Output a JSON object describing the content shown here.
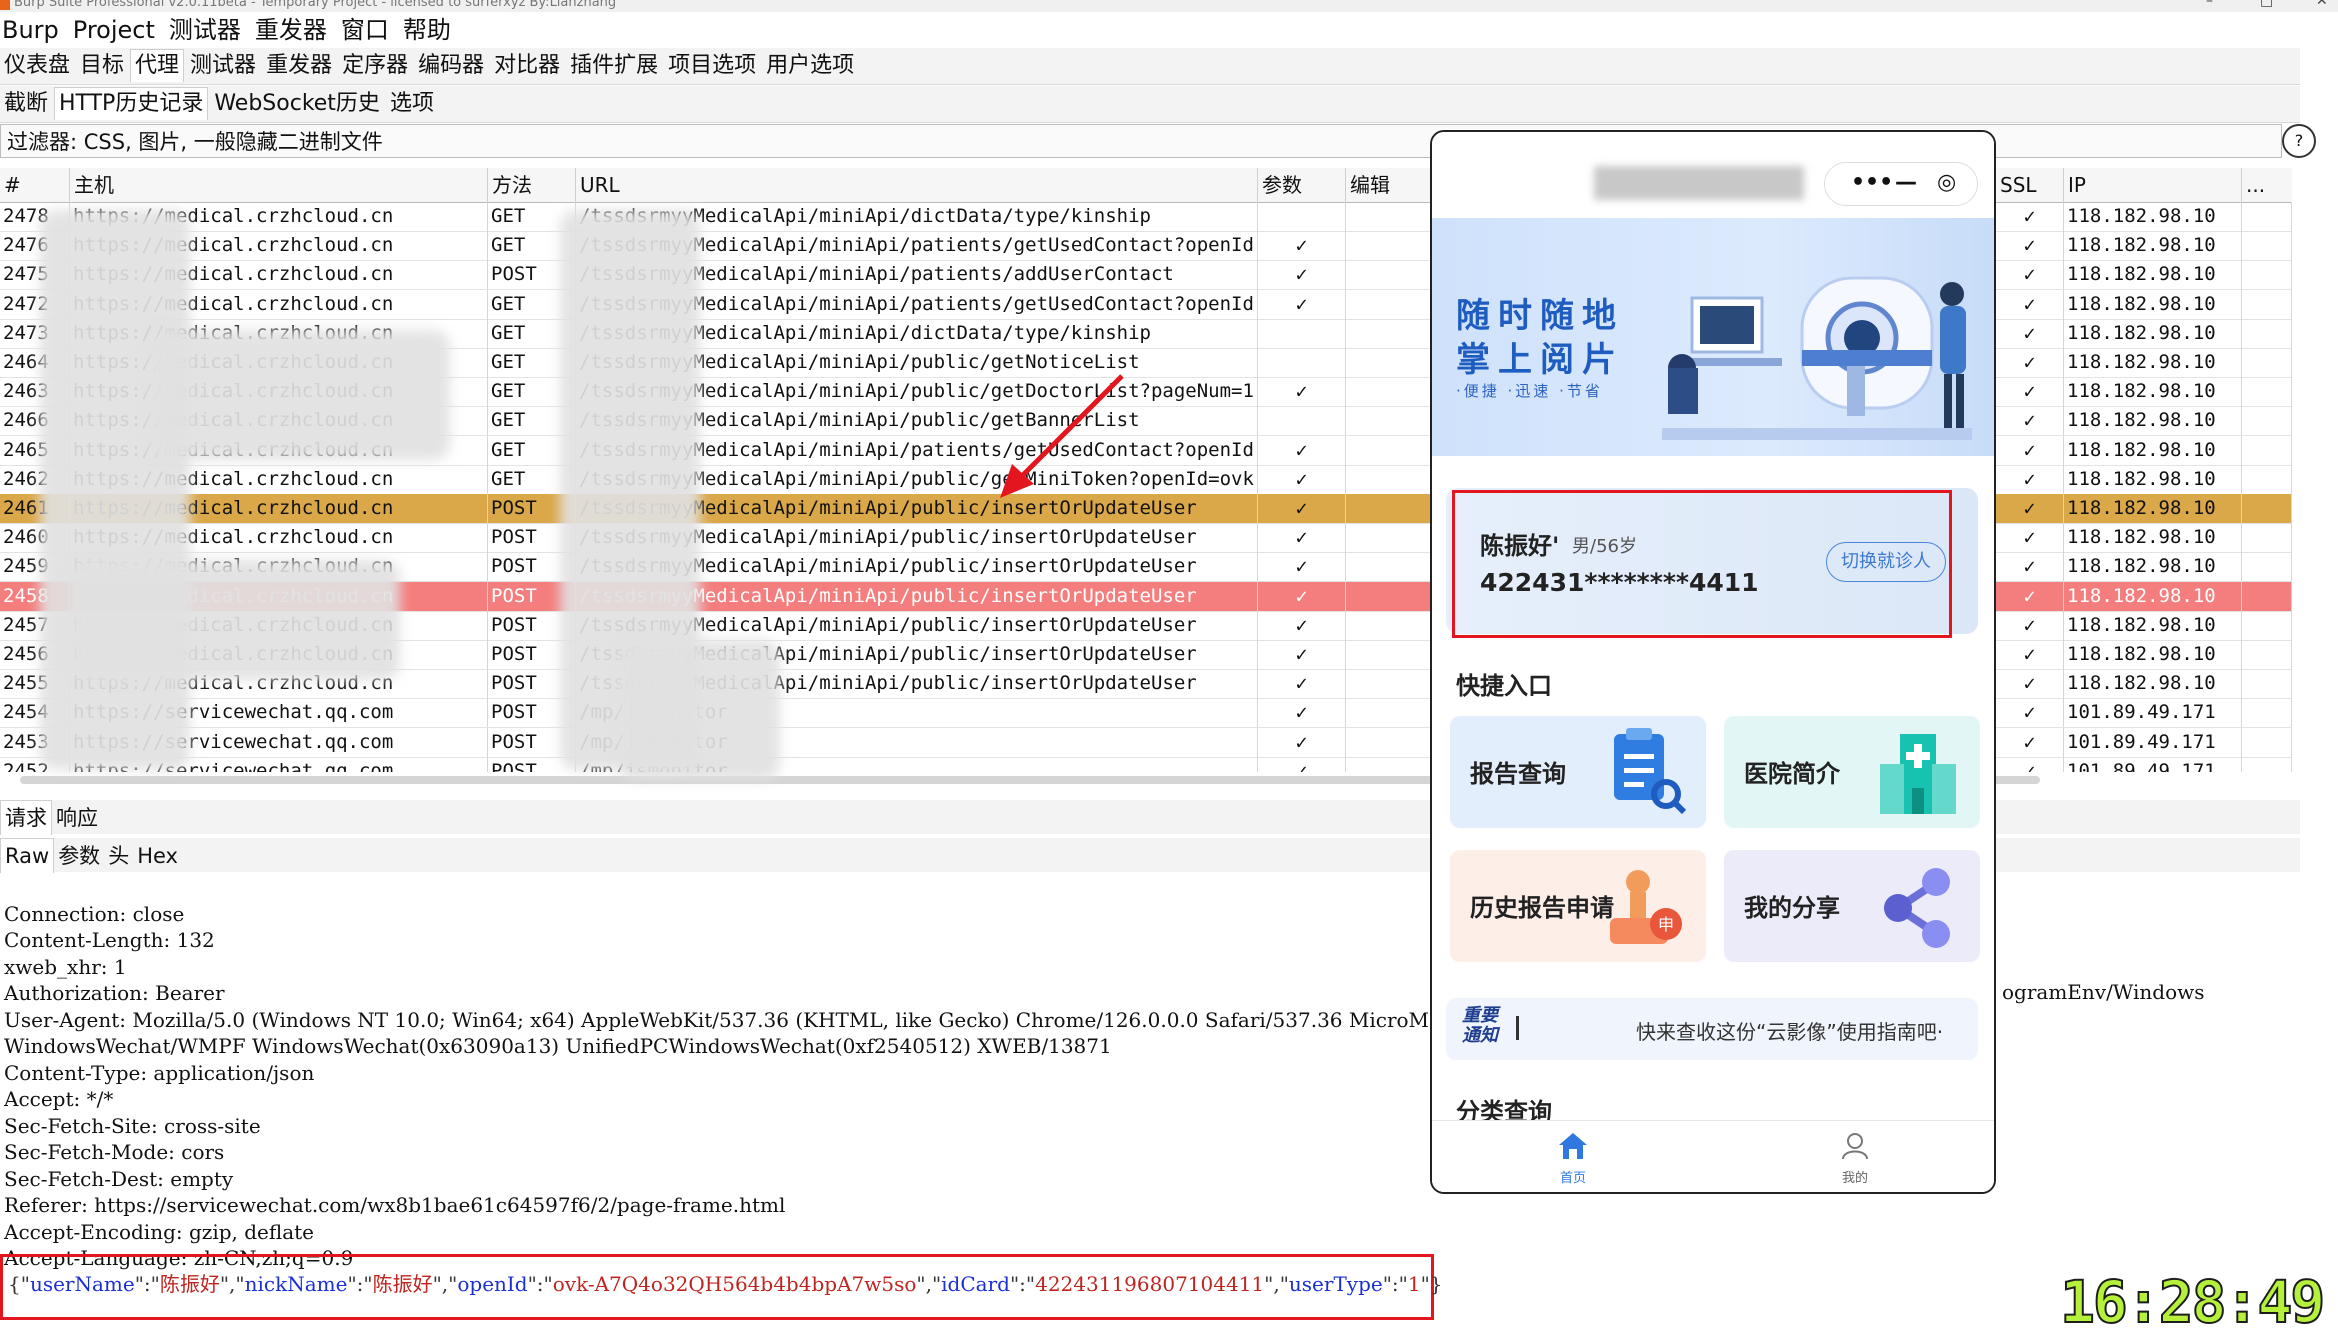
{
  "app": {
    "title": "Burp Suite Professional v2.0.11beta - Temporary Project - licensed to surferxyz By:Lianzhang",
    "menu": [
      "Burp",
      "Project",
      "测试器",
      "重发器",
      "窗口",
      "帮助"
    ],
    "main_tabs": [
      "仪表盘",
      "目标",
      "代理",
      "测试器",
      "重发器",
      "定序器",
      "编码器",
      "对比器",
      "插件扩展",
      "项目选项",
      "用户选项"
    ],
    "main_tab_selected": "代理",
    "proxy_tabs": [
      "截断",
      "HTTP历史记录",
      "WebSocket历史",
      "选项"
    ],
    "proxy_tab_selected": "HTTP历史记录",
    "filter": "过滤器: CSS, 图片, 一般隐藏二进制文件",
    "filter_icon": "?"
  },
  "table": {
    "headers": [
      "#",
      "主机",
      "方法",
      "URL",
      "参数",
      "编辑",
      "SSL",
      "IP",
      "..."
    ],
    "rows": [
      {
        "id": "2478",
        "host": "https://medical.crzhcloud.cn",
        "method": "GET",
        "url": "/tssdsrmyyMedicalApi/miniApi/dictData/type/kinship",
        "params": "",
        "ssl": "✓",
        "ip": "118.182.98.10",
        "hl": ""
      },
      {
        "id": "2476",
        "host": "https://medical.crzhcloud.cn",
        "method": "GET",
        "url": "/tssdsrmyyMedicalApi/miniApi/patients/getUsedContact?openId...",
        "params": "✓",
        "ssl": "✓",
        "ip": "118.182.98.10",
        "hl": ""
      },
      {
        "id": "2475",
        "host": "https://medical.crzhcloud.cn",
        "method": "POST",
        "url": "/tssdsrmyyMedicalApi/miniApi/patients/addUserContact",
        "params": "✓",
        "ssl": "✓",
        "ip": "118.182.98.10",
        "hl": ""
      },
      {
        "id": "2472",
        "host": "https://medical.crzhcloud.cn",
        "method": "GET",
        "url": "/tssdsrmyyMedicalApi/miniApi/patients/getUsedContact?openId...",
        "params": "✓",
        "ssl": "✓",
        "ip": "118.182.98.10",
        "hl": ""
      },
      {
        "id": "2473",
        "host": "https://medical.crzhcloud.cn",
        "method": "GET",
        "url": "/tssdsrmyyMedicalApi/miniApi/dictData/type/kinship",
        "params": "",
        "ssl": "✓",
        "ip": "118.182.98.10",
        "hl": ""
      },
      {
        "id": "2464",
        "host": "https://medical.crzhcloud.cn",
        "method": "GET",
        "url": "/tssdsrmyyMedicalApi/miniApi/public/getNoticeList",
        "params": "",
        "ssl": "✓",
        "ip": "118.182.98.10",
        "hl": ""
      },
      {
        "id": "2463",
        "host": "https://medical.crzhcloud.cn",
        "method": "GET",
        "url": "/tssdsrmyyMedicalApi/miniApi/public/getDoctorList?pageNum=1...",
        "params": "✓",
        "ssl": "✓",
        "ip": "118.182.98.10",
        "hl": ""
      },
      {
        "id": "2466",
        "host": "https://medical.crzhcloud.cn",
        "method": "GET",
        "url": "/tssdsrmyyMedicalApi/miniApi/public/getBannerList",
        "params": "",
        "ssl": "✓",
        "ip": "118.182.98.10",
        "hl": ""
      },
      {
        "id": "2465",
        "host": "https://medical.crzhcloud.cn",
        "method": "GET",
        "url": "/tssdsrmyyMedicalApi/miniApi/patients/getUsedContact?openId...",
        "params": "✓",
        "ssl": "✓",
        "ip": "118.182.98.10",
        "hl": ""
      },
      {
        "id": "2462",
        "host": "https://medical.crzhcloud.cn",
        "method": "GET",
        "url": "/tssdsrmyyMedicalApi/miniApi/public/getMiniToken?openId=ovk...",
        "params": "✓",
        "ssl": "✓",
        "ip": "118.182.98.10",
        "hl": ""
      },
      {
        "id": "2461",
        "host": "https://medical.crzhcloud.cn",
        "method": "POST",
        "url": "/tssdsrmyyMedicalApi/miniApi/public/insertOrUpdateUser",
        "params": "✓",
        "ssl": "✓",
        "ip": "118.182.98.10",
        "hl": "orange"
      },
      {
        "id": "2460",
        "host": "https://medical.crzhcloud.cn",
        "method": "POST",
        "url": "/tssdsrmyyMedicalApi/miniApi/public/insertOrUpdateUser",
        "params": "✓",
        "ssl": "✓",
        "ip": "118.182.98.10",
        "hl": ""
      },
      {
        "id": "2459",
        "host": "https://medical.crzhcloud.cn",
        "method": "POST",
        "url": "/tssdsrmyyMedicalApi/miniApi/public/insertOrUpdateUser",
        "params": "✓",
        "ssl": "✓",
        "ip": "118.182.98.10",
        "hl": ""
      },
      {
        "id": "2458",
        "host": "https://medical.crzhcloud.cn",
        "method": "POST",
        "url": "/tssdsrmyyMedicalApi/miniApi/public/insertOrUpdateUser",
        "params": "✓",
        "ssl": "✓",
        "ip": "118.182.98.10",
        "hl": "red"
      },
      {
        "id": "2457",
        "host": "https://medical.crzhcloud.cn",
        "method": "POST",
        "url": "/tssdsrmyyMedicalApi/miniApi/public/insertOrUpdateUser",
        "params": "✓",
        "ssl": "✓",
        "ip": "118.182.98.10",
        "hl": ""
      },
      {
        "id": "2456",
        "host": "https://medical.crzhcloud.cn",
        "method": "POST",
        "url": "/tssdsrmyyMedicalApi/miniApi/public/insertOrUpdateUser",
        "params": "✓",
        "ssl": "✓",
        "ip": "118.182.98.10",
        "hl": ""
      },
      {
        "id": "2455",
        "host": "https://medical.crzhcloud.cn",
        "method": "POST",
        "url": "/tssdsrmyyMedicalApi/miniApi/public/insertOrUpdateUser",
        "params": "✓",
        "ssl": "✓",
        "ip": "118.182.98.10",
        "hl": ""
      },
      {
        "id": "2454",
        "host": "https://servicewechat.qq.com",
        "method": "POST",
        "url": "/mp/jsmonitor",
        "params": "✓",
        "ssl": "✓",
        "ip": "101.89.49.171",
        "hl": ""
      },
      {
        "id": "2453",
        "host": "https://servicewechat.qq.com",
        "method": "POST",
        "url": "/mp/jsmonitor",
        "params": "✓",
        "ssl": "✓",
        "ip": "101.89.49.171",
        "hl": ""
      },
      {
        "id": "2452",
        "host": "https://servicewechat.qq.com",
        "method": "POST",
        "url": "/mp/jsmonitor",
        "params": "✓",
        "ssl": "✓",
        "ip": "101.89.49.171",
        "hl": ""
      }
    ]
  },
  "request": {
    "tabs": [
      "请求",
      "响应"
    ],
    "tab_selected": "请求",
    "view_tabs": [
      "Raw",
      "参数",
      "头",
      "Hex"
    ],
    "view_selected": "Raw",
    "lines": [
      "Connection: close",
      "Content-Length: 132",
      "xweb_xhr: 1",
      "Authorization: Bearer",
      "User-Agent: Mozilla/5.0 (Windows NT 10.0; Win64; x64) AppleWebKit/537.36 (KHTML, like Gecko) Chrome/126.0.0.0 Safari/537.36 MicroMe",
      "WindowsWechat/WMPF WindowsWechat(0x63090a13) UnifiedPCWindowsWechat(0xf2540512) XWEB/13871",
      "Content-Type: application/json",
      "Accept: */*",
      "Sec-Fetch-Site: cross-site",
      "Sec-Fetch-Mode: cors",
      "Sec-Fetch-Dest: empty",
      "Referer: https://servicewechat.com/wx8b1bae61c64597f6/2/page-frame.html",
      "Accept-Encoding: gzip, deflate",
      "Accept-Language: zh-CN,zh;q=0.9"
    ],
    "ua_tail": "ogramEnv/Windows",
    "json": {
      "k1": "userName",
      "v1": "陈振好",
      "k2": "nickName",
      "v2": "陈振好",
      "k3": "openId",
      "v3": "ovk-A7Q4o32QH564b4b4bpA7w5so",
      "k4": "idCard",
      "v4": "422431196807104411",
      "k5": "userType",
      "v5": "1"
    }
  },
  "phone": {
    "capsule_more": "•••",
    "capsule_min": "—",
    "capsule_close": "◎",
    "banner_line1": "随时随地",
    "banner_line2": "掌上阅片",
    "banner_line3": "·便捷 ·迅速 ·节省",
    "patient_name": "陈振好'",
    "patient_meta": "男/56岁",
    "patient_id": "422431********4411",
    "switch_label": "切换就诊人",
    "quick_title": "快捷入口",
    "tiles": [
      {
        "label": "报告查询",
        "icon": "report-search-icon",
        "bg": "#e3eefc"
      },
      {
        "label": "医院简介",
        "icon": "hospital-icon",
        "bg": "#e2f7f5"
      },
      {
        "label": "历史报告申请",
        "icon": "history-apply-icon",
        "bg": "#fdeee8"
      },
      {
        "label": "我的分享",
        "icon": "share-icon",
        "bg": "#ebebfa"
      }
    ],
    "notice_badge_1": "重要",
    "notice_badge_2": "通知",
    "notice_text": "快来查收这份“云影像”使用指南吧·",
    "category_title": "分类查询",
    "tab_home": "首页",
    "tab_mine": "我的",
    "accent": "#2f78e0"
  },
  "overlay": {
    "clock": "16:28:49"
  }
}
